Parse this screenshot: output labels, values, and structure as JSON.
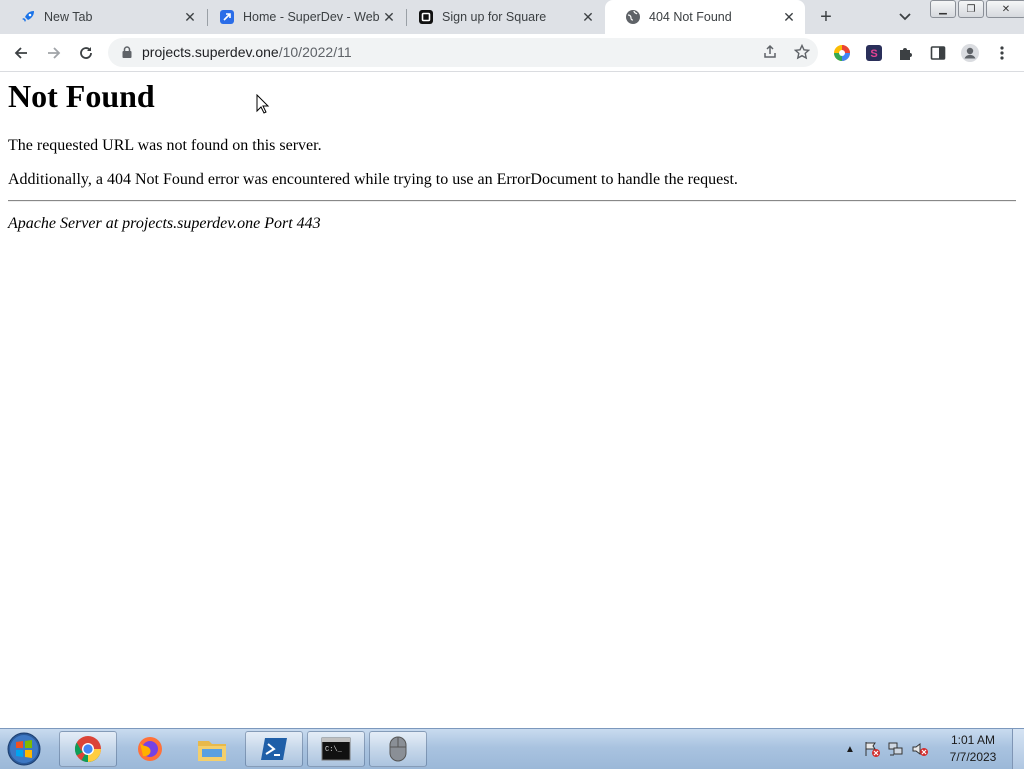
{
  "browser": {
    "tabs": [
      {
        "label": "New Tab",
        "icon": "rocket-icon",
        "active": false
      },
      {
        "label": "Home - SuperDev - Web",
        "icon": "superdev-icon",
        "active": false
      },
      {
        "label": "Sign up for Square",
        "icon": "square-logo-icon",
        "active": false
      },
      {
        "label": "404 Not Found",
        "icon": "globe-icon",
        "active": true
      }
    ],
    "url_host": "projects.superdev.one",
    "url_path": "/10/2022/11"
  },
  "page": {
    "heading": "Not Found",
    "message": "The requested URL was not found on this server.",
    "detail": "Additionally, a 404 Not Found error was encountered while trying to use an ErrorDocument to handle the request.",
    "signature": "Apache Server at projects.superdev.one Port 443"
  },
  "taskbar": {
    "apps": [
      "chrome-icon",
      "firefox-icon",
      "file-explorer-icon",
      "powershell-icon",
      "cmd-icon",
      "mouse-icon"
    ],
    "time": "1:01 AM",
    "date": "7/7/2023"
  },
  "colors": {
    "tabstrip": "#dee1e6",
    "omnibox": "#f1f3f4",
    "taskbar": "#a9c3e0"
  }
}
